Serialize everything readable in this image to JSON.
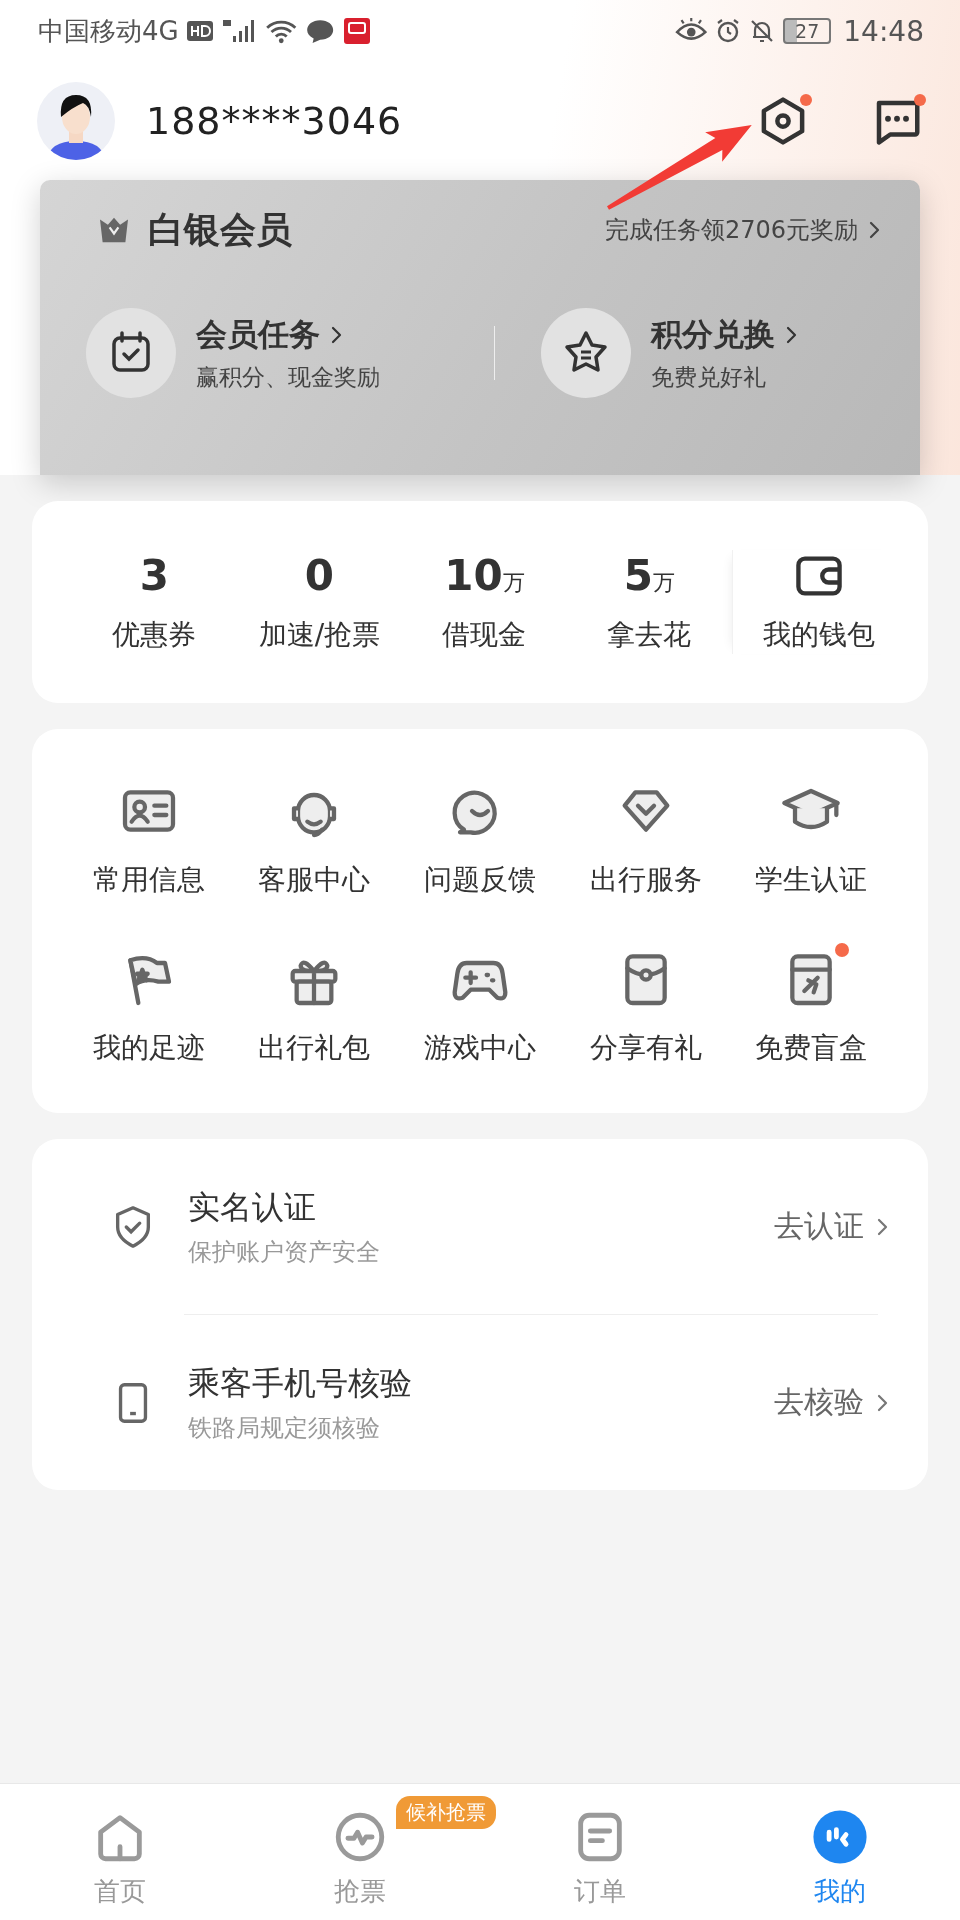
{
  "status_bar": {
    "carrier": "中国移动4G",
    "battery": "27",
    "time": "14:48"
  },
  "profile": {
    "phone": "188****3046",
    "settings_badge": true,
    "messages_badge": true
  },
  "membership": {
    "tier": "白银会员",
    "promo": "完成任务领2706元奖励",
    "actions": [
      {
        "title": "会员任务",
        "subtitle": "赢积分、现金奖励",
        "kind": "tasks"
      },
      {
        "title": "积分兑换",
        "subtitle": "免费兑好礼",
        "kind": "exchange"
      }
    ]
  },
  "stats": [
    {
      "value": "3",
      "label": "优惠券"
    },
    {
      "value": "0",
      "label": "加速/抢票"
    },
    {
      "value": "10",
      "unit": "万",
      "label": "借现金"
    },
    {
      "value": "5",
      "unit": "万",
      "label": "拿去花"
    }
  ],
  "wallet": {
    "label": "我的钱包"
  },
  "services": [
    {
      "label": "常用信息",
      "kind": "id-card",
      "badge": false
    },
    {
      "label": "客服中心",
      "kind": "headset",
      "badge": false
    },
    {
      "label": "问题反馈",
      "kind": "chat",
      "badge": false
    },
    {
      "label": "出行服务",
      "kind": "diamond",
      "badge": false
    },
    {
      "label": "学生认证",
      "kind": "cap",
      "badge": false
    },
    {
      "label": "我的足迹",
      "kind": "flag",
      "badge": false
    },
    {
      "label": "出行礼包",
      "kind": "gift",
      "badge": false
    },
    {
      "label": "游戏中心",
      "kind": "gamepad",
      "badge": false
    },
    {
      "label": "分享有礼",
      "kind": "envelope",
      "badge": false
    },
    {
      "label": "免费盲盒",
      "kind": "box",
      "badge": true
    }
  ],
  "verifications": [
    {
      "title": "实名认证",
      "subtitle": "保护账户资产安全",
      "action": "去认证",
      "kind": "shield"
    },
    {
      "title": "乘客手机号核验",
      "subtitle": "铁路局规定须核验",
      "action": "去核验",
      "kind": "phone"
    }
  ],
  "tab_bar": [
    {
      "label": "首页",
      "kind": "home",
      "selected": false
    },
    {
      "label": "抢票",
      "kind": "pulse",
      "selected": false,
      "badge": "候补抢票"
    },
    {
      "label": "订单",
      "kind": "order",
      "selected": false
    },
    {
      "label": "我的",
      "kind": "mine",
      "selected": true
    }
  ]
}
